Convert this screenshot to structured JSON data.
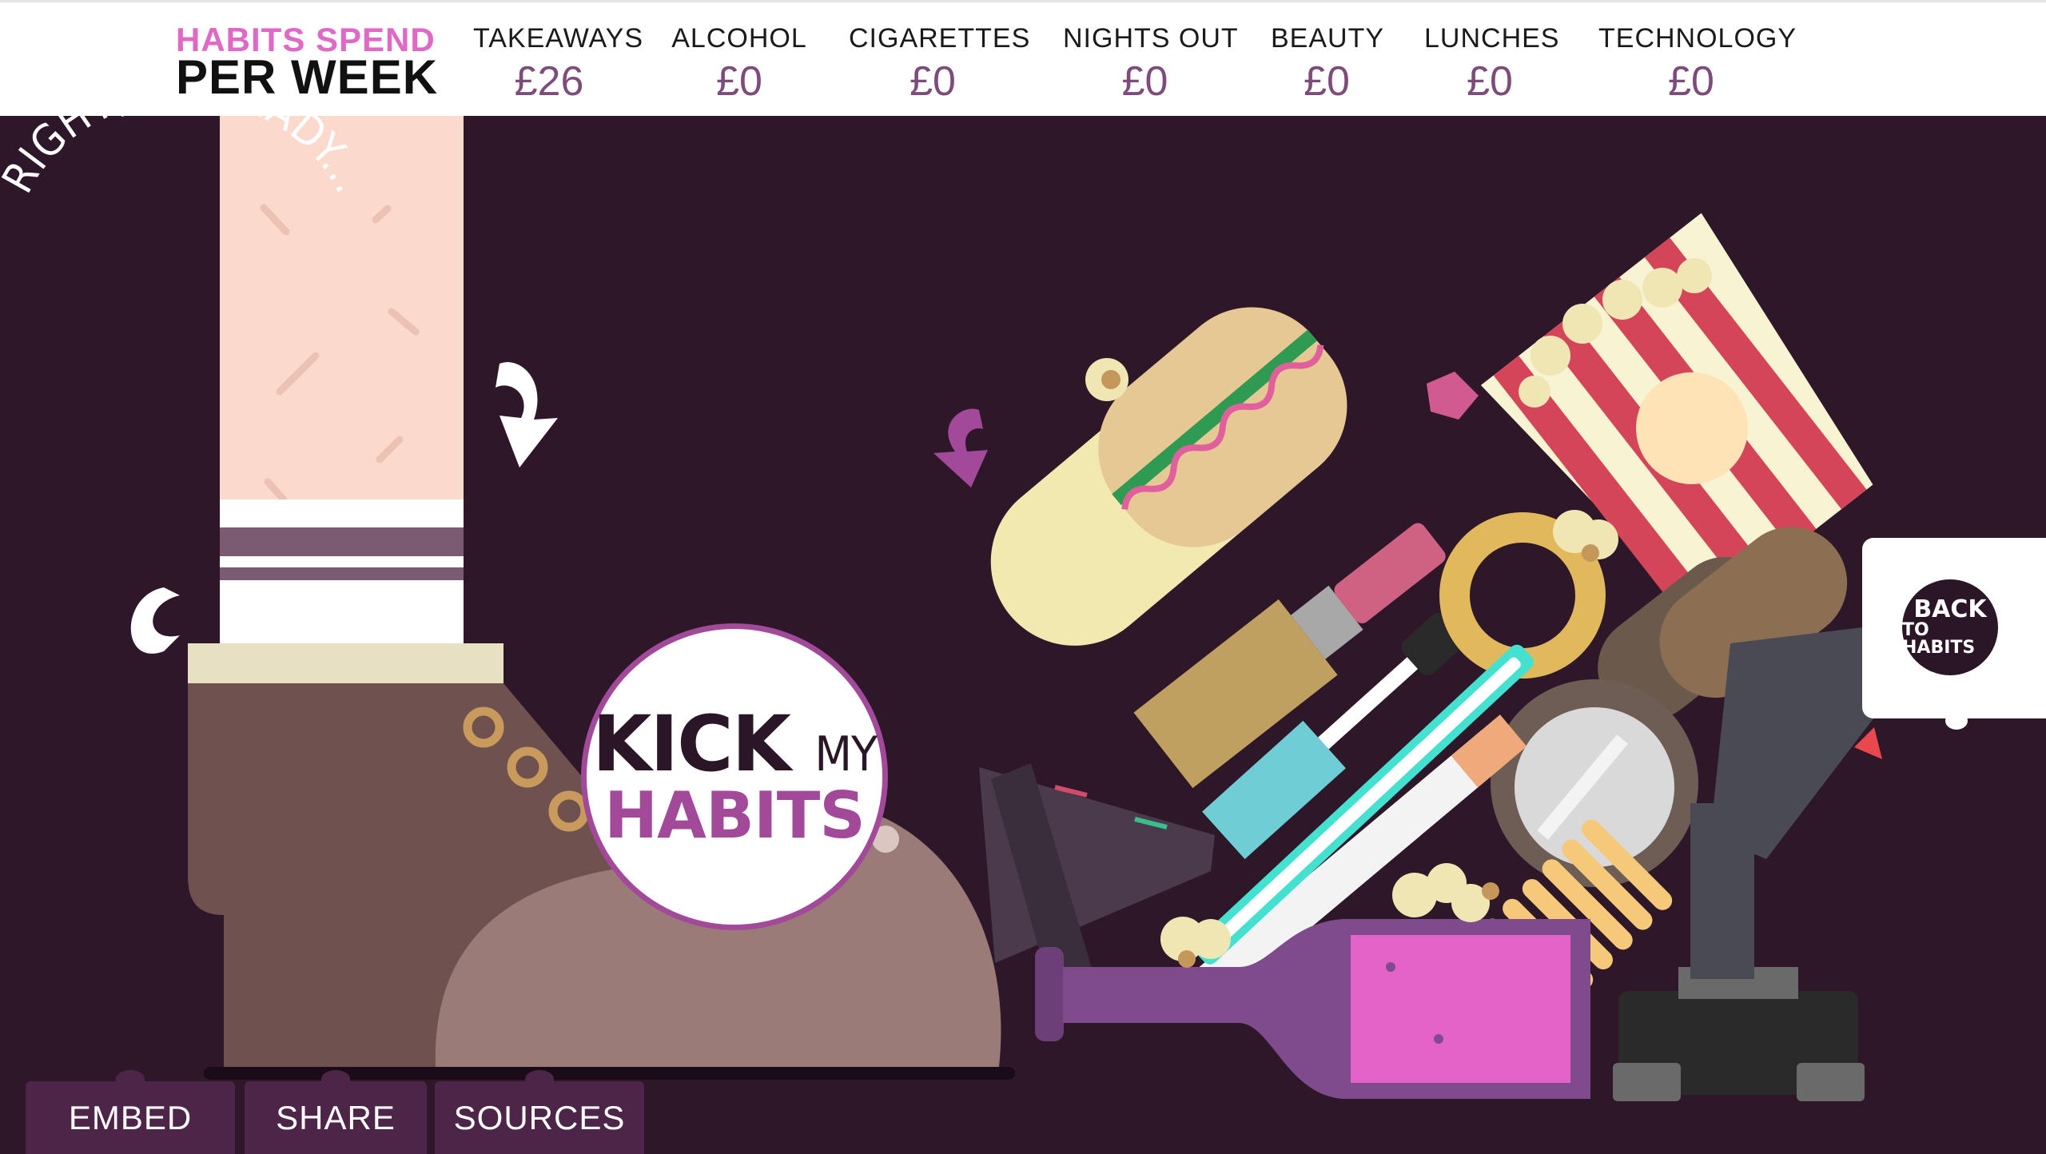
{
  "header": {
    "brand_line1": "HABITS SPEND",
    "brand_line2": "PER WEEK",
    "categories": [
      {
        "name": "TAKEAWAYS",
        "value": "£26"
      },
      {
        "name": "ALCOHOL",
        "value": "£0"
      },
      {
        "name": "CIGARETTES",
        "value": "£0"
      },
      {
        "name": "NIGHTS OUT",
        "value": "£0"
      },
      {
        "name": "BEAUTY",
        "value": "£0"
      },
      {
        "name": "LUNCHES",
        "value": "£0"
      },
      {
        "name": "TECHNOLOGY",
        "value": "£0"
      }
    ]
  },
  "hero": {
    "ready_text": "RIGHT, I'M READY...",
    "kick_button": {
      "word1": "KICK",
      "word2": "MY",
      "word3": "HABITS"
    }
  },
  "back_tab": {
    "line1": "BACK",
    "line2": "TO HABITS"
  },
  "footer_tabs": {
    "embed": "EMBED",
    "share": "SHARE",
    "sources": "SOURCES"
  },
  "colors": {
    "background": "#2d1729",
    "accent_pink": "#e169c6",
    "accent_purple": "#a24a99",
    "value_purple": "#7e4c7a",
    "tab_bg": "#4d2548"
  },
  "icons": [
    "arrow-curved-white-icon",
    "arrow-curved-purple-icon",
    "boot-illustration",
    "habit-objects-illustration",
    "back-to-habits-badge"
  ]
}
